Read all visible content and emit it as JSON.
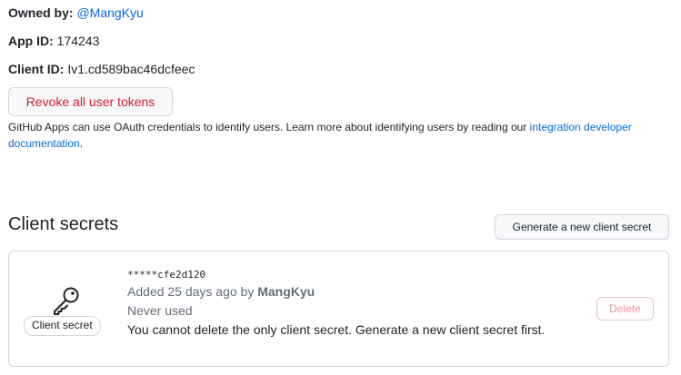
{
  "app_info": {
    "owned_by_label": "Owned by:",
    "owned_by_value": "@MangKyu",
    "app_id_label": "App ID:",
    "app_id_value": "174243",
    "client_id_label": "Client ID:",
    "client_id_value": "Iv1.cd589bac46dcfeec"
  },
  "revoke_button_label": "Revoke all user tokens",
  "oauth_note": {
    "text": "GitHub Apps can use OAuth credentials to identify users. Learn more about identifying users by reading our ",
    "link_text": "integration developer documentation",
    "suffix": "."
  },
  "client_secrets": {
    "title": "Client secrets",
    "generate_button_label": "Generate a new client secret",
    "secret": {
      "badge_label": "Client secret",
      "icon": "key-icon",
      "masked_value": "*****cfe2d120",
      "added_text": "Added 25 days ago by ",
      "added_by": "MangKyu",
      "usage": "Never used",
      "warning": "You cannot delete the only client secret. Generate a new client secret first.",
      "delete_button_label": "Delete"
    }
  }
}
